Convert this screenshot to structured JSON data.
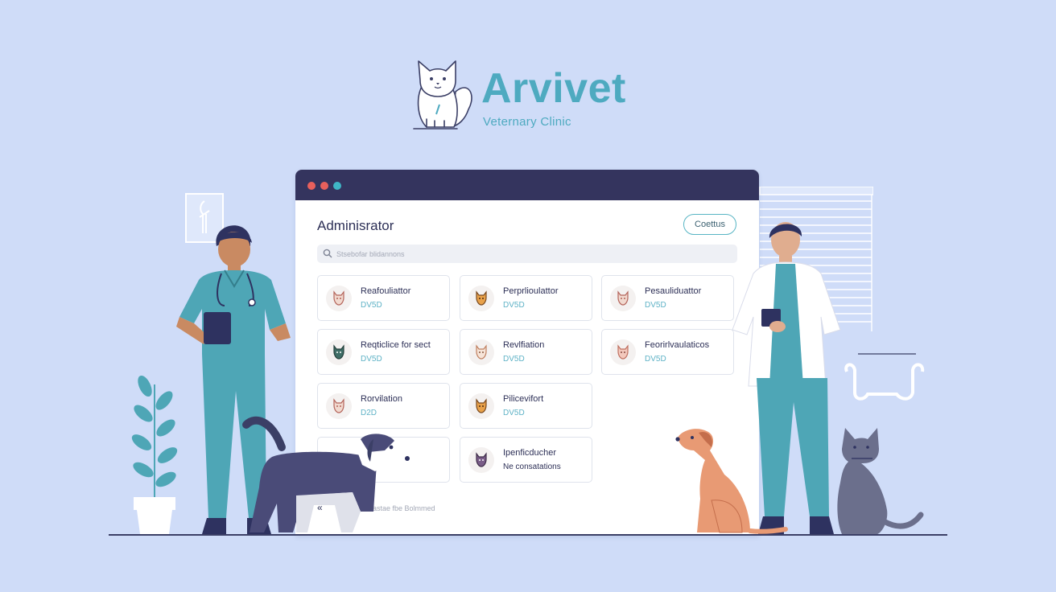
{
  "brand": {
    "name": "Arvivet",
    "subtitle": "Veternary Clinic",
    "logo_icon": "cat-logo-icon"
  },
  "window": {
    "controls": [
      "#e8605c",
      "#e8605c",
      "#3fb6c6"
    ],
    "page_title": "Adminisrator",
    "header_button": "Coettus",
    "search": {
      "placeholder": "Stsebofar blidannons"
    },
    "cards": [
      {
        "title": "Reafouliattor",
        "subtitle": "DV5D",
        "icon": "dog-icon"
      },
      {
        "title": "Perprlioulattor",
        "subtitle": "DV5D",
        "icon": "dog-icon"
      },
      {
        "title": "Pesauliduattor",
        "subtitle": "DV5D",
        "icon": "dog-icon"
      },
      {
        "title": "Reqticlice for sect",
        "subtitle": "DV5D",
        "icon": "dog-icon"
      },
      {
        "title": "Revlfiation",
        "subtitle": "DV5D",
        "icon": "dog-icon"
      },
      {
        "title": "Feorirlvaulaticos",
        "subtitle": "DV5D",
        "icon": "dog-icon"
      },
      {
        "title": "Rorvilation",
        "subtitle": "D2D",
        "icon": "dog-icon"
      },
      {
        "title": "Pilicevifort",
        "subtitle": "DV5D",
        "icon": "dog-icon"
      },
      {
        "title": "Ipenficducher",
        "subtitle": "Ne consatations",
        "icon": "dog-icon"
      }
    ],
    "pager_prev": "«",
    "footer_text": "Sastae fbe Bolmmed"
  },
  "colors": {
    "accent": "#4eaac0",
    "navy": "#34345e",
    "background": "#cfdcf8"
  }
}
